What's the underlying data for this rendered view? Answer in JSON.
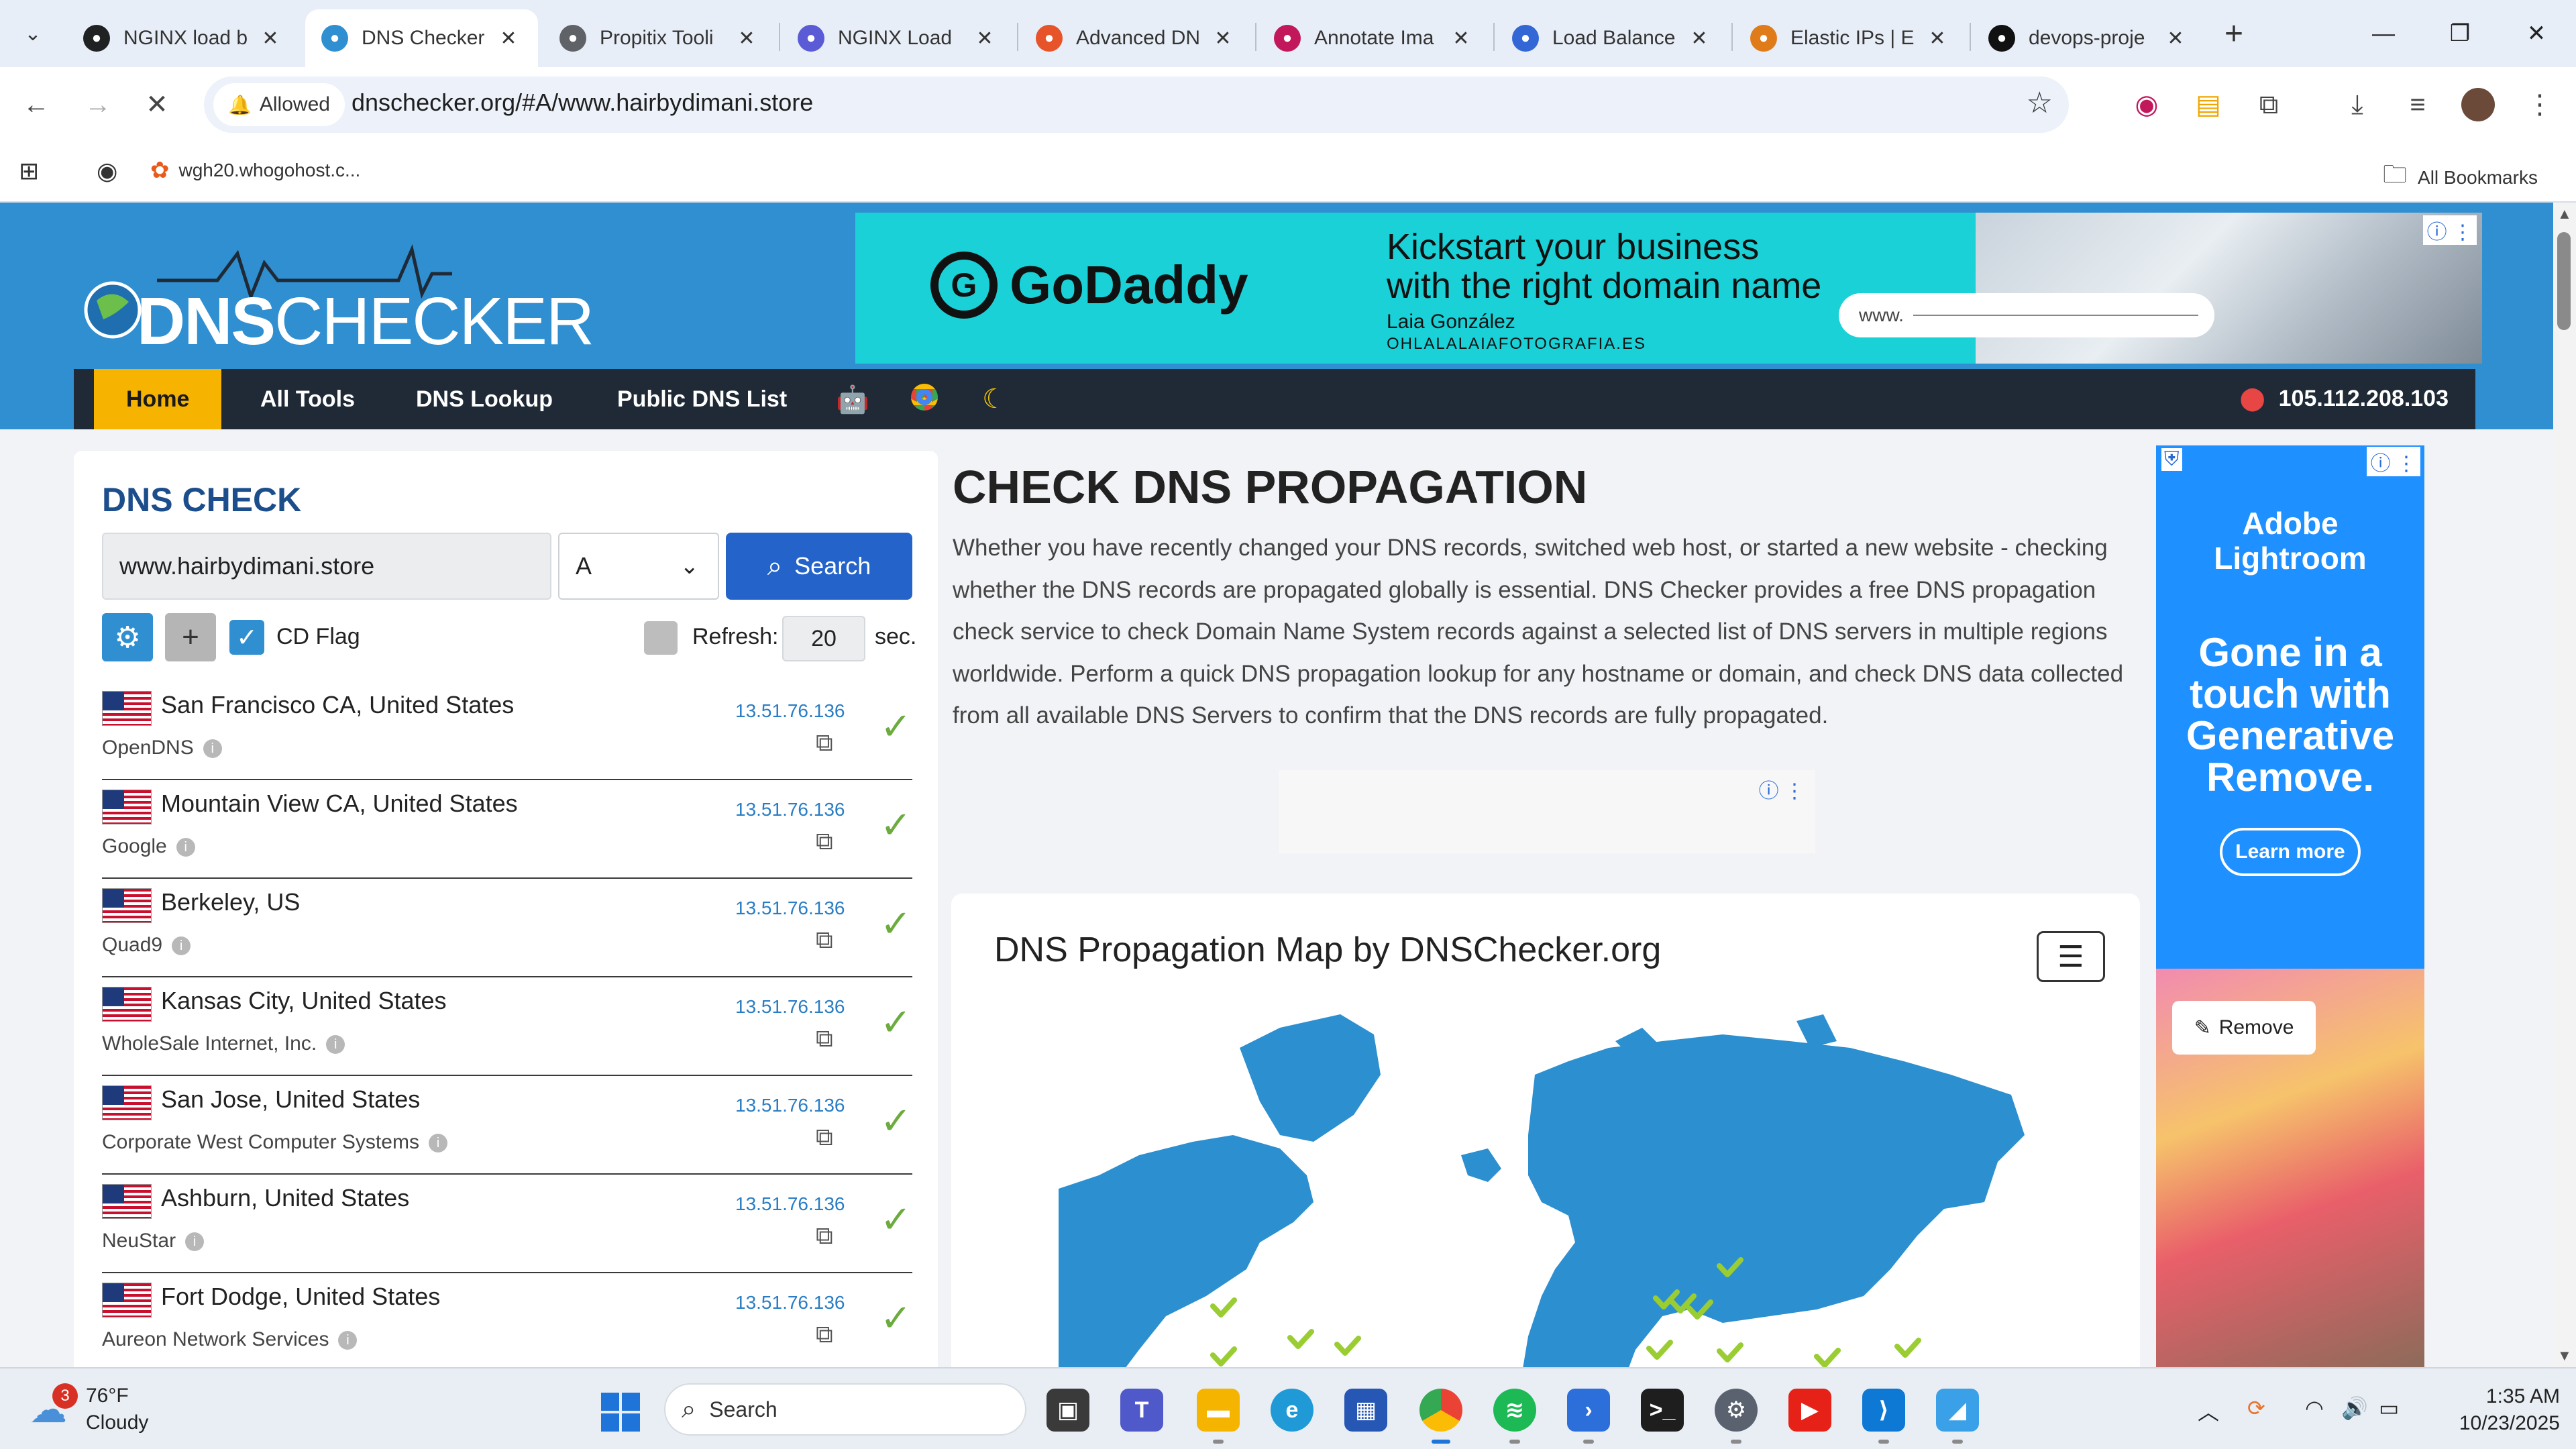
{
  "browser": {
    "tabs": [
      {
        "title": "NGINX load b",
        "icon": "openai-icon",
        "color": "#202123",
        "active": false
      },
      {
        "title": "DNS Checker",
        "icon": "dnschecker-icon",
        "color": "#2f8fd1",
        "active": true
      },
      {
        "title": "Propitix Tooli",
        "icon": "globe-icon",
        "color": "#5f6368",
        "active": false
      },
      {
        "title": "NGINX Load",
        "icon": "claude-icon",
        "color": "#5b5bd6",
        "active": false
      },
      {
        "title": "Advanced DN",
        "icon": "zoho-icon",
        "color": "#e8542a",
        "active": false
      },
      {
        "title": "Annotate Ima",
        "icon": "annotate-icon",
        "color": "#c2185b",
        "active": false
      },
      {
        "title": "Load Balance",
        "icon": "diagram-icon",
        "color": "#3367d6",
        "active": false
      },
      {
        "title": "Elastic IPs | E",
        "icon": "aws-icon",
        "color": "#e07b1a",
        "active": false
      },
      {
        "title": "devops-proje",
        "icon": "github-icon",
        "color": "#111111",
        "active": false
      }
    ],
    "permission_chip": "Allowed",
    "url": "dnschecker.org/#A/www.hairbydimani.store",
    "bookmarks": {
      "item": "wgh20.whogohost.c...",
      "all": "All Bookmarks"
    }
  },
  "site": {
    "logo": {
      "strong": "DNS",
      "light": "CHECKER"
    },
    "nav": {
      "home": "Home",
      "all_tools": "All Tools",
      "dns_lookup": "DNS Lookup",
      "public_dns": "Public DNS List",
      "ip": "105.112.208.103"
    },
    "ad_top": {
      "brand": "GoDaddy",
      "headline_1": "Kickstart your business",
      "headline_2": "with the right domain name",
      "person": "Laia González",
      "site": "OHLALALAIAFOTOGRAFIA.ES",
      "input_hint": "www."
    }
  },
  "dns_check": {
    "title": "DNS CHECK",
    "domain": "www.hairbydimani.store",
    "record_type": "A",
    "search_label": "Search",
    "cd_flag_label": "CD Flag",
    "refresh_label": "Refresh:",
    "refresh_value": "20",
    "refresh_unit": "sec.",
    "results": [
      {
        "location": "San Francisco CA, United States",
        "provider": "OpenDNS",
        "ip": "13.51.76.136"
      },
      {
        "location": "Mountain View CA, United States",
        "provider": "Google",
        "ip": "13.51.76.136"
      },
      {
        "location": "Berkeley, US",
        "provider": "Quad9",
        "ip": "13.51.76.136"
      },
      {
        "location": "Kansas City, United States",
        "provider": "WholeSale Internet, Inc.",
        "ip": "13.51.76.136"
      },
      {
        "location": "San Jose, United States",
        "provider": "Corporate West Computer Systems",
        "ip": "13.51.76.136"
      },
      {
        "location": "Ashburn, United States",
        "provider": "NeuStar",
        "ip": "13.51.76.136"
      },
      {
        "location": "Fort Dodge, United States",
        "provider": "Aureon Network Services",
        "ip": "13.51.76.136"
      }
    ]
  },
  "main": {
    "title": "CHECK DNS PROPAGATION",
    "description": "Whether you have recently changed your DNS records, switched web host, or started a new website - checking whether the DNS records are propagated globally is essential. DNS Checker provides a free DNS propagation check service to check Domain Name System records against a selected list of DNS servers in multiple regions worldwide. Perform a quick DNS propagation lookup for any hostname or domain, and check DNS data collected from all available DNS Servers to confirm that the DNS records are fully propagated.",
    "map_title": "DNS Propagation Map by DNSChecker.org"
  },
  "ad_right": {
    "brand_1": "Adobe",
    "brand_2": "Lightroom",
    "pitch": [
      "Gone in a",
      "touch with",
      "Generative",
      "Remove."
    ],
    "learn_more": "Learn more",
    "remove": "Remove"
  },
  "taskbar": {
    "weather": {
      "temp": "76°F",
      "condition": "Cloudy",
      "badge": "3"
    },
    "search": "Search",
    "time": "1:35 AM",
    "date": "10/23/2025"
  }
}
